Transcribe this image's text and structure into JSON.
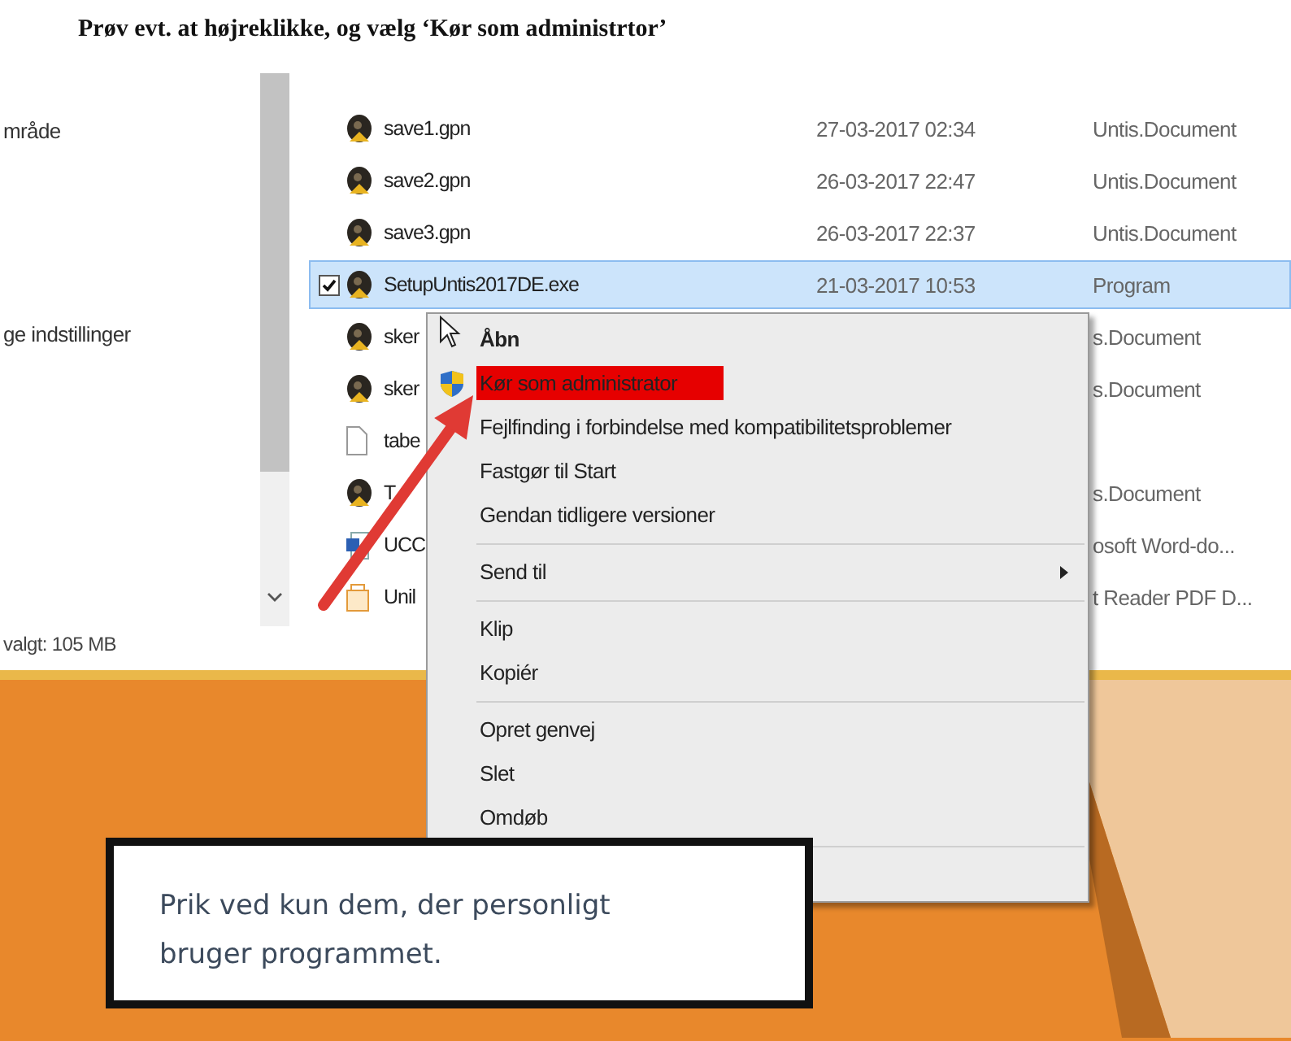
{
  "instruction": "Prøv evt. at højreklikke, og vælg ‘Kør som administrtor’",
  "navigation": [
    {
      "label": "mråde"
    },
    {
      "label": "ge indstillinger"
    }
  ],
  "files": [
    {
      "name": "save1.gpn",
      "date": "27-03-2017 02:34",
      "type": "Untis.Document",
      "kind": "untis",
      "selected": false,
      "checked": false
    },
    {
      "name": "save2.gpn",
      "date": "26-03-2017 22:47",
      "type": "Untis.Document",
      "kind": "untis",
      "selected": false,
      "checked": false
    },
    {
      "name": "save3.gpn",
      "date": "26-03-2017 22:37",
      "type": "Untis.Document",
      "kind": "untis",
      "selected": false,
      "checked": false
    },
    {
      "name": "SetupUntis2017DE.exe",
      "date": "21-03-2017 10:53",
      "type": "Program",
      "kind": "untis",
      "selected": true,
      "checked": true
    },
    {
      "name": "sker",
      "type": "s.Document",
      "kind": "untis",
      "selected": false,
      "checked": false
    },
    {
      "name": "sker",
      "type": "s.Document",
      "kind": "untis",
      "selected": false,
      "checked": false
    },
    {
      "name": "tabe",
      "kind": "blank",
      "selected": false,
      "checked": false
    },
    {
      "name": "T",
      "type": "s.Document",
      "kind": "untis",
      "selected": false,
      "checked": false
    },
    {
      "name": "UCC",
      "type": "osoft Word-do...",
      "kind": "word",
      "selected": false,
      "checked": false
    },
    {
      "name": "Unil",
      "type": "t Reader PDF D...",
      "kind": "pdf",
      "selected": false,
      "checked": false
    }
  ],
  "status_bar": "valgt: 105 MB",
  "context_menu": [
    {
      "kind": "item",
      "label": "Åbn",
      "default": true,
      "selected": false
    },
    {
      "kind": "elevated",
      "label": "Kør som administrator",
      "selected": true
    },
    {
      "kind": "item",
      "label": "Fejlfinding i forbindelse med kompatibilitetsproblemer",
      "selected": false
    },
    {
      "kind": "item",
      "label": "Fastgør til Start",
      "selected": false
    },
    {
      "kind": "item",
      "label": "Gendan tidligere versioner",
      "selected": false
    },
    {
      "kind": "separator"
    },
    {
      "kind": "item",
      "label": "Send til",
      "submenu": true,
      "selected": false
    },
    {
      "kind": "separator"
    },
    {
      "kind": "item",
      "label": "Klip",
      "selected": false
    },
    {
      "kind": "item",
      "label": "Kopiér",
      "selected": false
    },
    {
      "kind": "separator"
    },
    {
      "kind": "item",
      "label": "Opret genvej",
      "selected": false
    },
    {
      "kind": "item",
      "label": "Slet",
      "selected": false
    },
    {
      "kind": "item",
      "label": "Omdøb",
      "selected": false
    },
    {
      "kind": "separator"
    }
  ],
  "callout": "Prik ved kun dem, der personligt bruger programmet."
}
